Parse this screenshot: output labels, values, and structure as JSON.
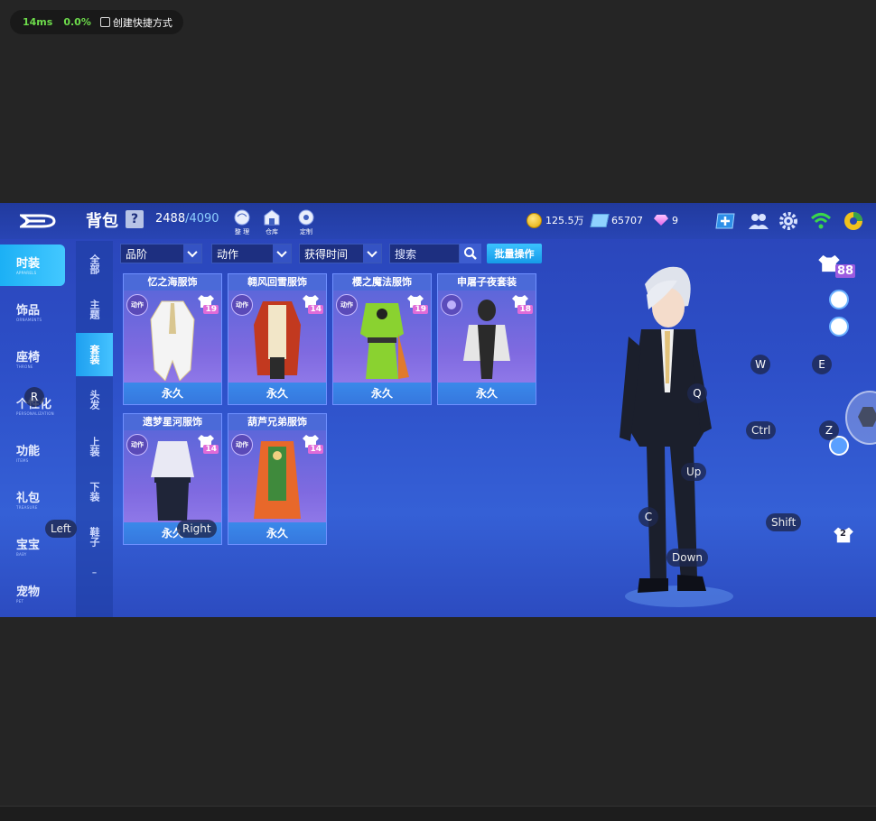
{
  "perf": {
    "ms": "14ms",
    "percent": "0.0%",
    "shortcut": "创建快捷方式"
  },
  "header": {
    "title": "背包",
    "help": "?",
    "capacity_used": "2488",
    "capacity_max": "/4090",
    "buttons": [
      {
        "id": "sort",
        "label": "整 理"
      },
      {
        "id": "warehouse",
        "label": "仓库"
      },
      {
        "id": "custom",
        "label": "定制"
      }
    ],
    "gold": "125.5万",
    "tickets": "65707",
    "diamonds": "9"
  },
  "sidebar": {
    "items": [
      {
        "zh": "时装",
        "en": "APPARELS",
        "active": true
      },
      {
        "zh": "饰品",
        "en": "ORNAMENTS"
      },
      {
        "zh": "座椅",
        "en": "THRONE"
      },
      {
        "zh": "个性化",
        "en": "PERSONALIZATION"
      },
      {
        "zh": "功能",
        "en": "ITEMS"
      },
      {
        "zh": "礼包",
        "en": "TREASURE"
      },
      {
        "zh": "宝宝",
        "en": "BABY"
      },
      {
        "zh": "宠物",
        "en": "PET"
      }
    ]
  },
  "subnav": {
    "items": [
      {
        "label": "全部"
      },
      {
        "label": "主题"
      },
      {
        "label": "套装",
        "active": true
      },
      {
        "label": "头发"
      },
      {
        "label": "上装"
      },
      {
        "label": "下装"
      },
      {
        "label": "鞋子"
      }
    ]
  },
  "filters": {
    "quality": "品阶",
    "action": "动作",
    "time": "获得时间",
    "search": "搜索",
    "batch": "批量操作"
  },
  "cards": [
    {
      "name": "忆之海服饰",
      "level": "19",
      "action": "动作",
      "duration": "永久",
      "colors": [
        "#f4f4f4",
        "#d9c690"
      ]
    },
    {
      "name": "翱风回雪服饰",
      "level": "14",
      "action": "动作",
      "duration": "永久",
      "colors": [
        "#c2391f",
        "#f2e6c8"
      ]
    },
    {
      "name": "樱之魔法服饰",
      "level": "19",
      "action": "动作",
      "duration": "永久",
      "colors": [
        "#8ad230",
        "#e07a2c"
      ]
    },
    {
      "name": "申屠子夜套装",
      "level": "18",
      "action": "",
      "duration": "永久",
      "colors": [
        "#2a2a2a",
        "#e6e6e6"
      ]
    },
    {
      "name": "遗梦星河服饰",
      "level": "14",
      "action": "动作",
      "duration": "永久",
      "colors": [
        "#e9e9f4",
        "#1f2538"
      ]
    },
    {
      "name": "葫芦兄弟服饰",
      "level": "14",
      "action": "动作",
      "duration": "永久",
      "colors": [
        "#e8682a",
        "#3f8a3c"
      ]
    }
  ],
  "character": {
    "level": "88",
    "badge": "2"
  },
  "keys": {
    "r": "R",
    "left": "Left",
    "right": "Right",
    "w": "W",
    "e": "E",
    "q": "Q",
    "ctrl": "Ctrl",
    "z": "Z",
    "up": "Up",
    "c": "C",
    "shift": "Shift",
    "down": "Down"
  }
}
